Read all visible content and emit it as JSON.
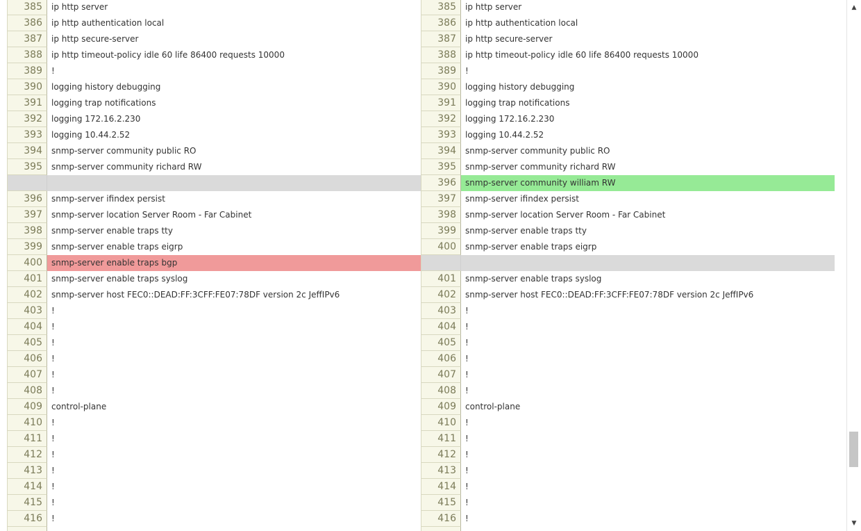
{
  "left_pane": {
    "rows": [
      {
        "num": "385",
        "text": "ip http server",
        "type": "normal"
      },
      {
        "num": "386",
        "text": "ip http authentication local",
        "type": "normal"
      },
      {
        "num": "387",
        "text": "ip http secure-server",
        "type": "normal"
      },
      {
        "num": "388",
        "text": "ip http timeout-policy idle 60 life 86400 requests 10000",
        "type": "normal"
      },
      {
        "num": "389",
        "text": "!",
        "type": "normal"
      },
      {
        "num": "390",
        "text": "logging history debugging",
        "type": "normal"
      },
      {
        "num": "391",
        "text": "logging trap notifications",
        "type": "normal"
      },
      {
        "num": "392",
        "text": "logging 172.16.2.230",
        "type": "normal"
      },
      {
        "num": "393",
        "text": "logging 10.44.2.52",
        "type": "normal"
      },
      {
        "num": "394",
        "text": "snmp-server community public RO",
        "type": "normal"
      },
      {
        "num": "395",
        "text": "snmp-server community richard RW",
        "type": "normal"
      },
      {
        "num": "",
        "text": "",
        "type": "empty"
      },
      {
        "num": "396",
        "text": "snmp-server ifindex persist",
        "type": "normal"
      },
      {
        "num": "397",
        "text": "snmp-server location Server Room - Far Cabinet",
        "type": "normal"
      },
      {
        "num": "398",
        "text": "snmp-server enable traps tty",
        "type": "normal"
      },
      {
        "num": "399",
        "text": "snmp-server enable traps eigrp",
        "type": "normal"
      },
      {
        "num": "400",
        "text": "snmp-server enable traps bgp",
        "type": "removed"
      },
      {
        "num": "401",
        "text": "snmp-server enable traps syslog",
        "type": "normal"
      },
      {
        "num": "402",
        "text": "snmp-server host FEC0::DEAD:FF:3CFF:FE07:78DF version 2c JeffIPv6",
        "type": "normal"
      },
      {
        "num": "403",
        "text": "!",
        "type": "normal"
      },
      {
        "num": "404",
        "text": "!",
        "type": "normal"
      },
      {
        "num": "405",
        "text": "!",
        "type": "normal"
      },
      {
        "num": "406",
        "text": "!",
        "type": "normal"
      },
      {
        "num": "407",
        "text": "!",
        "type": "normal"
      },
      {
        "num": "408",
        "text": "!",
        "type": "normal"
      },
      {
        "num": "409",
        "text": "control-plane",
        "type": "normal"
      },
      {
        "num": "410",
        "text": "!",
        "type": "normal"
      },
      {
        "num": "411",
        "text": "!",
        "type": "normal"
      },
      {
        "num": "412",
        "text": "!",
        "type": "normal"
      },
      {
        "num": "413",
        "text": "!",
        "type": "normal"
      },
      {
        "num": "414",
        "text": "!",
        "type": "normal"
      },
      {
        "num": "415",
        "text": "!",
        "type": "normal"
      },
      {
        "num": "416",
        "text": "!",
        "type": "normal"
      },
      {
        "num": "",
        "text": "",
        "type": "normal"
      }
    ]
  },
  "right_pane": {
    "rows": [
      {
        "num": "385",
        "text": "ip http server",
        "type": "normal"
      },
      {
        "num": "386",
        "text": "ip http authentication local",
        "type": "normal"
      },
      {
        "num": "387",
        "text": "ip http secure-server",
        "type": "normal"
      },
      {
        "num": "388",
        "text": "ip http timeout-policy idle 60 life 86400 requests 10000",
        "type": "normal"
      },
      {
        "num": "389",
        "text": "!",
        "type": "normal"
      },
      {
        "num": "390",
        "text": "logging history debugging",
        "type": "normal"
      },
      {
        "num": "391",
        "text": "logging trap notifications",
        "type": "normal"
      },
      {
        "num": "392",
        "text": "logging 172.16.2.230",
        "type": "normal"
      },
      {
        "num": "393",
        "text": "logging 10.44.2.52",
        "type": "normal"
      },
      {
        "num": "394",
        "text": "snmp-server community public RO",
        "type": "normal"
      },
      {
        "num": "395",
        "text": "snmp-server community richard RW",
        "type": "normal"
      },
      {
        "num": "396",
        "text": "snmp-server community william RW",
        "type": "added"
      },
      {
        "num": "397",
        "text": "snmp-server ifindex persist",
        "type": "normal"
      },
      {
        "num": "398",
        "text": "snmp-server location Server Room - Far Cabinet",
        "type": "normal"
      },
      {
        "num": "399",
        "text": "snmp-server enable traps tty",
        "type": "normal"
      },
      {
        "num": "400",
        "text": "snmp-server enable traps eigrp",
        "type": "normal"
      },
      {
        "num": "",
        "text": "",
        "type": "empty"
      },
      {
        "num": "401",
        "text": "snmp-server enable traps syslog",
        "type": "normal"
      },
      {
        "num": "402",
        "text": "snmp-server host FEC0::DEAD:FF:3CFF:FE07:78DF version 2c JeffIPv6",
        "type": "normal"
      },
      {
        "num": "403",
        "text": "!",
        "type": "normal"
      },
      {
        "num": "404",
        "text": "!",
        "type": "normal"
      },
      {
        "num": "405",
        "text": "!",
        "type": "normal"
      },
      {
        "num": "406",
        "text": "!",
        "type": "normal"
      },
      {
        "num": "407",
        "text": "!",
        "type": "normal"
      },
      {
        "num": "408",
        "text": "!",
        "type": "normal"
      },
      {
        "num": "409",
        "text": "control-plane",
        "type": "normal"
      },
      {
        "num": "410",
        "text": "!",
        "type": "normal"
      },
      {
        "num": "411",
        "text": "!",
        "type": "normal"
      },
      {
        "num": "412",
        "text": "!",
        "type": "normal"
      },
      {
        "num": "413",
        "text": "!",
        "type": "normal"
      },
      {
        "num": "414",
        "text": "!",
        "type": "normal"
      },
      {
        "num": "415",
        "text": "!",
        "type": "normal"
      },
      {
        "num": "416",
        "text": "!",
        "type": "normal"
      },
      {
        "num": "",
        "text": "",
        "type": "normal"
      }
    ]
  },
  "scrollbar": {
    "up_icon": "triangle-up",
    "down_icon": "triangle-down"
  },
  "colors": {
    "removed_line": "#f09a9a",
    "added_line": "#96ea96",
    "empty_line": "#dadada",
    "gutter": "#f7f7e8"
  }
}
